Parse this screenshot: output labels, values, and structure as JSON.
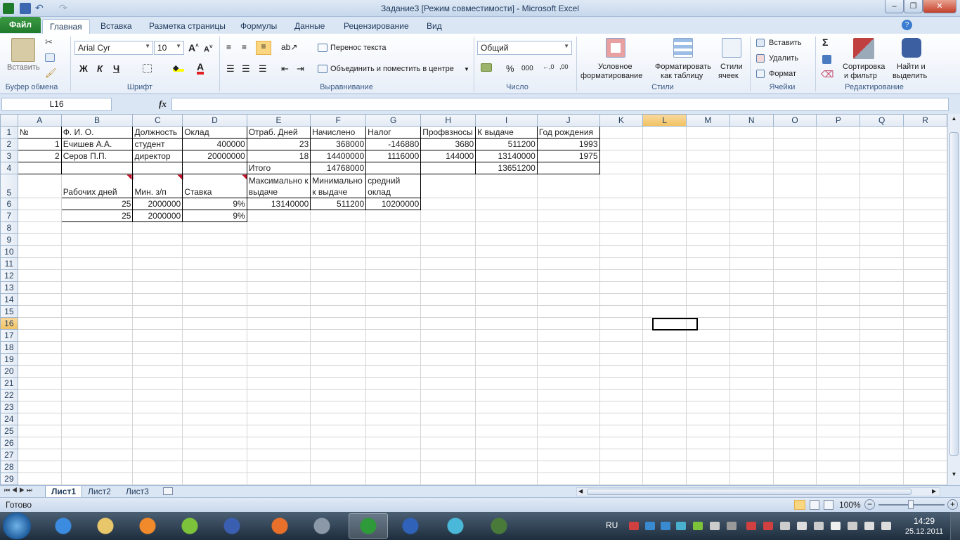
{
  "window": {
    "title": "Задание3  [Режим совместимости]  -  Microsoft Excel"
  },
  "tabs": {
    "file": "Файл",
    "items": [
      "Главная",
      "Вставка",
      "Разметка страницы",
      "Формулы",
      "Данные",
      "Рецензирование",
      "Вид"
    ]
  },
  "ribbon": {
    "clipboard": {
      "group": "Буфер обмена",
      "paste": "Вставить"
    },
    "font": {
      "group": "Шрифт",
      "name": "Arial Cyr",
      "size": "10",
      "bold": "Ж",
      "italic": "К",
      "underline": "Ч"
    },
    "alignment": {
      "group": "Выравнивание",
      "wrap": "Перенос текста",
      "merge": "Объединить и поместить в центре"
    },
    "number": {
      "group": "Число",
      "format": "Общий",
      "percent": "%",
      "thousands": "000"
    },
    "styles": {
      "group": "Стили",
      "conditional_1": "Условное",
      "conditional_2": "форматирование",
      "astable_1": "Форматировать",
      "astable_2": "как таблицу",
      "cellstyles_1": "Стили",
      "cellstyles_2": "ячеек"
    },
    "cells": {
      "group": "Ячейки",
      "insert": "Вставить",
      "delete": "Удалить",
      "format": "Формат"
    },
    "editing": {
      "group": "Редактирование",
      "sum": "Σ",
      "sort_1": "Сортировка",
      "sort_2": "и фильтр",
      "find_1": "Найти и",
      "find_2": "выделить"
    }
  },
  "formula_bar": {
    "name_box": "L16",
    "fx": "fx",
    "value": ""
  },
  "columns": [
    "A",
    "B",
    "C",
    "D",
    "E",
    "F",
    "G",
    "H",
    "I",
    "J",
    "K",
    "L",
    "M",
    "N",
    "O",
    "P",
    "Q",
    "R"
  ],
  "rows": [
    {
      "n": "1",
      "cells": [
        "№",
        "Ф. И. О.",
        "Должность",
        "Оклад",
        "Отраб. Дней",
        "Начислено",
        "Налог",
        "Профвзносы",
        "К выдаче",
        "Год рождения",
        "",
        "",
        "",
        "",
        "",
        "",
        "",
        ""
      ]
    },
    {
      "n": "2",
      "cells": [
        "1",
        "Ечишев А.А.",
        "студент",
        "400000",
        "23",
        "368000",
        "-146880",
        "3680",
        "511200",
        "1993",
        "",
        "",
        "",
        "",
        "",
        "",
        "",
        ""
      ]
    },
    {
      "n": "3",
      "cells": [
        "2",
        "Серов П.П.",
        "директор",
        "20000000",
        "18",
        "14400000",
        "1116000",
        "144000",
        "13140000",
        "1975",
        "",
        "",
        "",
        "",
        "",
        "",
        "",
        ""
      ]
    },
    {
      "n": "4",
      "cells": [
        "",
        "",
        "",
        "",
        "Итого",
        "14768000",
        "",
        "",
        "13651200",
        "",
        "",
        "",
        "",
        "",
        "",
        "",
        "",
        ""
      ]
    },
    {
      "n": "5",
      "cells": [
        "",
        "Рабочих дней",
        "Мин. з/п",
        "Ставка",
        "Максимально к выдаче",
        "Минимально к выдаче",
        "средний оклад",
        "",
        "",
        "",
        "",
        "",
        "",
        "",
        "",
        "",
        "",
        ""
      ]
    },
    {
      "n": "6",
      "cells": [
        "",
        "25",
        "2000000",
        "9%",
        "13140000",
        "511200",
        "10200000",
        "",
        "",
        "",
        "",
        "",
        "",
        "",
        "",
        "",
        "",
        ""
      ]
    },
    {
      "n": "7",
      "cells": [
        "",
        "25",
        "2000000",
        "9%",
        "",
        "",
        "",
        "",
        "",
        "",
        "",
        "",
        "",
        "",
        "",
        "",
        "",
        ""
      ]
    }
  ],
  "empty_rows": [
    "8",
    "9",
    "10",
    "11",
    "12",
    "13",
    "14",
    "15",
    "16",
    "17",
    "18",
    "19",
    "20",
    "21",
    "22",
    "23",
    "24",
    "25",
    "26",
    "27",
    "28",
    "29"
  ],
  "sheets": [
    "Лист1",
    "Лист2",
    "Лист3"
  ],
  "status": {
    "ready": "Готово",
    "zoom": "100%"
  },
  "taskbar": {
    "lang": "RU",
    "time": "14:29",
    "date": "25.12.2011"
  },
  "colors": {
    "excel_green": "#1f7a2b",
    "selection_header": "#f1c15f",
    "ribbon_blue": "#dbe6f4"
  }
}
